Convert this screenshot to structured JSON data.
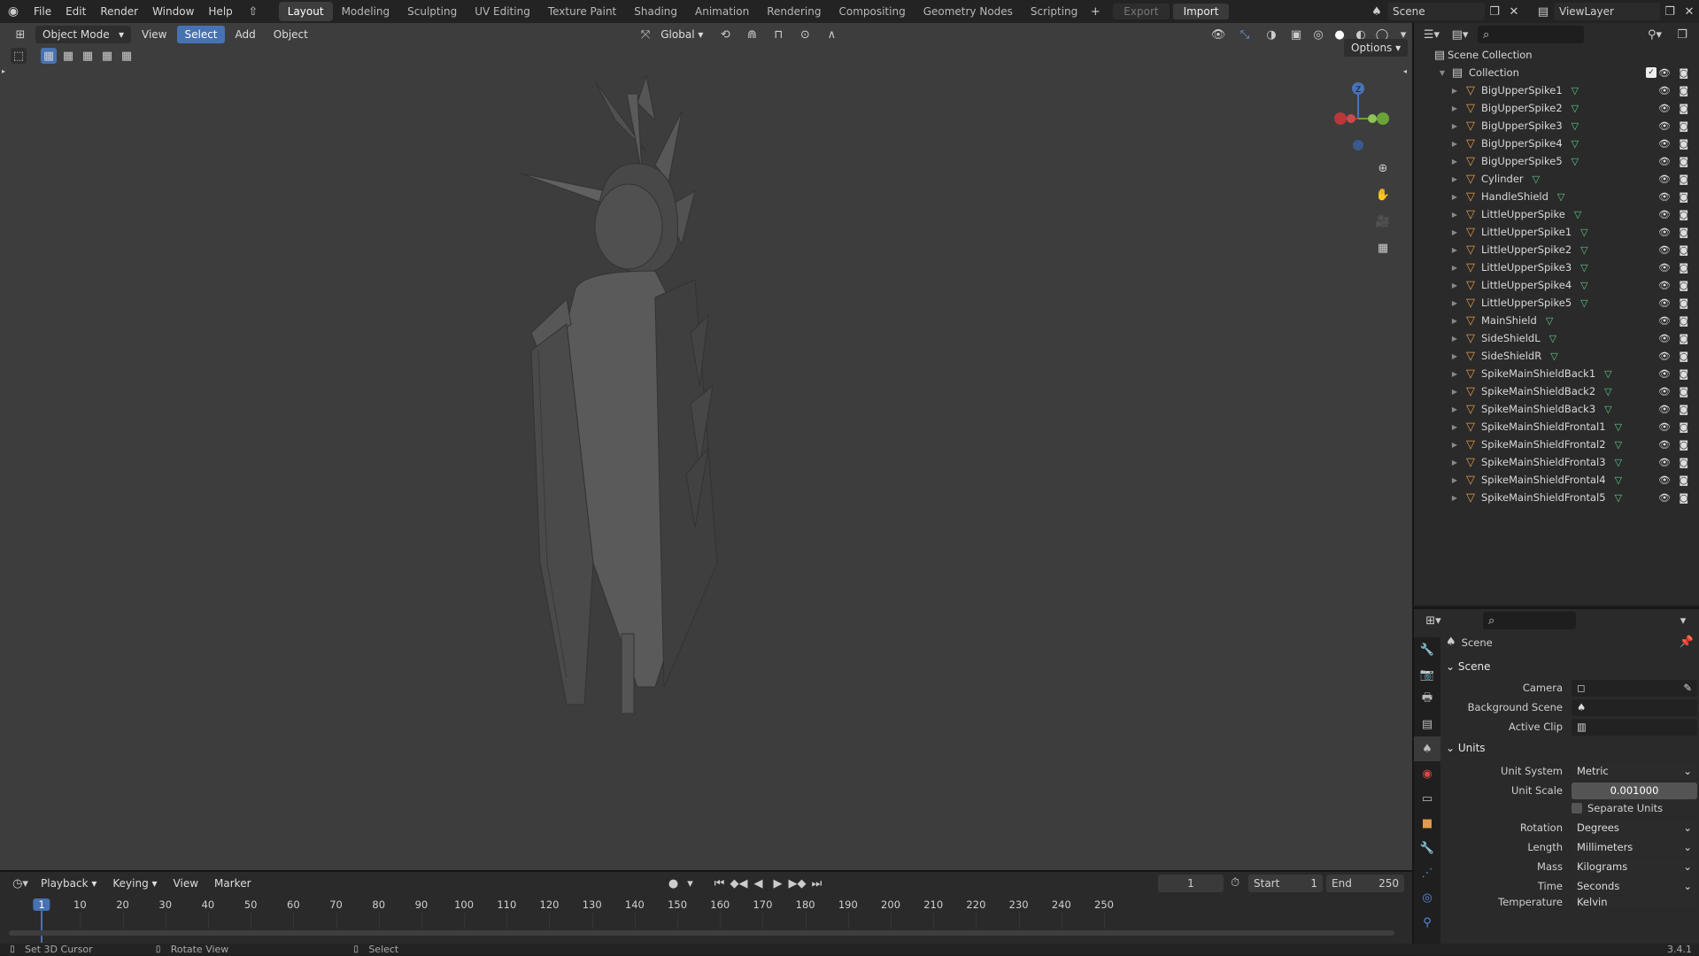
{
  "topbar": {
    "menus": [
      "File",
      "Edit",
      "Render",
      "Window",
      "Help"
    ],
    "workspaces": [
      "Layout",
      "Modeling",
      "Sculpting",
      "UV Editing",
      "Texture Paint",
      "Shading",
      "Animation",
      "Rendering",
      "Compositing",
      "Geometry Nodes",
      "Scripting"
    ],
    "active_workspace": "Layout",
    "export_label": "Export",
    "import_label": "Import",
    "scene_name": "Scene",
    "viewlayer_name": "ViewLayer"
  },
  "viewport": {
    "mode": "Object Mode",
    "menus": [
      "View",
      "Select",
      "Add",
      "Object"
    ],
    "selected_menu": "Select",
    "transform_orientation": "Global",
    "options_label": "Options"
  },
  "outliner": {
    "scene_collection": "Scene Collection",
    "collection": "Collection",
    "items": [
      "BigUpperSpike1",
      "BigUpperSpike2",
      "BigUpperSpike3",
      "BigUpperSpike4",
      "BigUpperSpike5",
      "Cylinder",
      "HandleShield",
      "LittleUpperSpike",
      "LittleUpperSpike1",
      "LittleUpperSpike2",
      "LittleUpperSpike3",
      "LittleUpperSpike4",
      "LittleUpperSpike5",
      "MainShield",
      "SideShieldL",
      "SideShieldR",
      "SpikeMainShieldBack1",
      "SpikeMainShieldBack2",
      "SpikeMainShieldBack3",
      "SpikeMainShieldFrontal1",
      "SpikeMainShieldFrontal2",
      "SpikeMainShieldFrontal3",
      "SpikeMainShieldFrontal4",
      "SpikeMainShieldFrontal5"
    ]
  },
  "properties": {
    "context": "Scene",
    "scene_section": "Scene",
    "camera_label": "Camera",
    "background_scene_label": "Background Scene",
    "active_clip_label": "Active Clip",
    "units_section": "Units",
    "unit_system_label": "Unit System",
    "unit_system": "Metric",
    "unit_scale_label": "Unit Scale",
    "unit_scale": "0.001000",
    "separate_units_label": "Separate Units",
    "rotation_label": "Rotation",
    "rotation": "Degrees",
    "length_label": "Length",
    "length": "Millimeters",
    "mass_label": "Mass",
    "mass": "Kilograms",
    "time_label": "Time",
    "time": "Seconds",
    "temperature_label": "Temperature",
    "temperature": "Kelvin"
  },
  "timeline": {
    "menus": [
      "Playback",
      "Keying",
      "View",
      "Marker"
    ],
    "current_frame": "1",
    "start_label": "Start",
    "start": "1",
    "end_label": "End",
    "end": "250",
    "ticks": [
      "1",
      "10",
      "20",
      "30",
      "40",
      "50",
      "60",
      "70",
      "80",
      "90",
      "100",
      "110",
      "120",
      "130",
      "140",
      "150",
      "160",
      "170",
      "180",
      "190",
      "200",
      "210",
      "220",
      "230",
      "240",
      "250"
    ]
  },
  "status": {
    "left": "Set 3D Cursor",
    "middle": "Rotate View",
    "right": "Select",
    "version": "3.4.1"
  },
  "colors": {
    "accent": "#4772b3",
    "object_icon": "#e39a4c",
    "mesh_icon": "#5fc78a",
    "frame_indicator": "#4772b3"
  }
}
